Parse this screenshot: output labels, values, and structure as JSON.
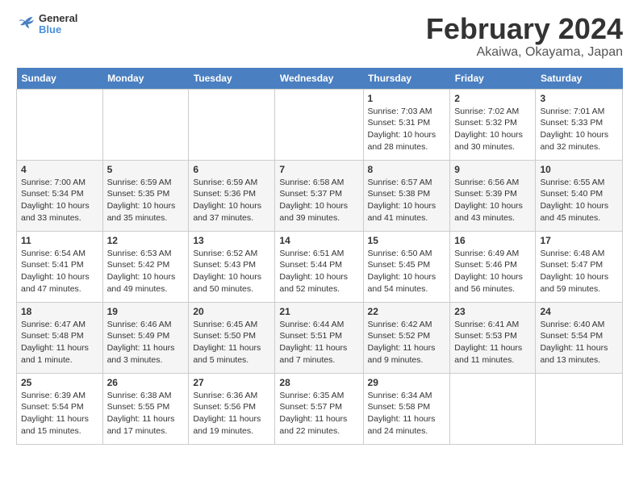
{
  "header": {
    "logo_general": "General",
    "logo_blue": "Blue",
    "month_title": "February 2024",
    "location": "Akaiwa, Okayama, Japan"
  },
  "weekdays": [
    "Sunday",
    "Monday",
    "Tuesday",
    "Wednesday",
    "Thursday",
    "Friday",
    "Saturday"
  ],
  "weeks": [
    [
      {
        "day": "",
        "detail": ""
      },
      {
        "day": "",
        "detail": ""
      },
      {
        "day": "",
        "detail": ""
      },
      {
        "day": "",
        "detail": ""
      },
      {
        "day": "1",
        "detail": "Sunrise: 7:03 AM\nSunset: 5:31 PM\nDaylight: 10 hours\nand 28 minutes."
      },
      {
        "day": "2",
        "detail": "Sunrise: 7:02 AM\nSunset: 5:32 PM\nDaylight: 10 hours\nand 30 minutes."
      },
      {
        "day": "3",
        "detail": "Sunrise: 7:01 AM\nSunset: 5:33 PM\nDaylight: 10 hours\nand 32 minutes."
      }
    ],
    [
      {
        "day": "4",
        "detail": "Sunrise: 7:00 AM\nSunset: 5:34 PM\nDaylight: 10 hours\nand 33 minutes."
      },
      {
        "day": "5",
        "detail": "Sunrise: 6:59 AM\nSunset: 5:35 PM\nDaylight: 10 hours\nand 35 minutes."
      },
      {
        "day": "6",
        "detail": "Sunrise: 6:59 AM\nSunset: 5:36 PM\nDaylight: 10 hours\nand 37 minutes."
      },
      {
        "day": "7",
        "detail": "Sunrise: 6:58 AM\nSunset: 5:37 PM\nDaylight: 10 hours\nand 39 minutes."
      },
      {
        "day": "8",
        "detail": "Sunrise: 6:57 AM\nSunset: 5:38 PM\nDaylight: 10 hours\nand 41 minutes."
      },
      {
        "day": "9",
        "detail": "Sunrise: 6:56 AM\nSunset: 5:39 PM\nDaylight: 10 hours\nand 43 minutes."
      },
      {
        "day": "10",
        "detail": "Sunrise: 6:55 AM\nSunset: 5:40 PM\nDaylight: 10 hours\nand 45 minutes."
      }
    ],
    [
      {
        "day": "11",
        "detail": "Sunrise: 6:54 AM\nSunset: 5:41 PM\nDaylight: 10 hours\nand 47 minutes."
      },
      {
        "day": "12",
        "detail": "Sunrise: 6:53 AM\nSunset: 5:42 PM\nDaylight: 10 hours\nand 49 minutes."
      },
      {
        "day": "13",
        "detail": "Sunrise: 6:52 AM\nSunset: 5:43 PM\nDaylight: 10 hours\nand 50 minutes."
      },
      {
        "day": "14",
        "detail": "Sunrise: 6:51 AM\nSunset: 5:44 PM\nDaylight: 10 hours\nand 52 minutes."
      },
      {
        "day": "15",
        "detail": "Sunrise: 6:50 AM\nSunset: 5:45 PM\nDaylight: 10 hours\nand 54 minutes."
      },
      {
        "day": "16",
        "detail": "Sunrise: 6:49 AM\nSunset: 5:46 PM\nDaylight: 10 hours\nand 56 minutes."
      },
      {
        "day": "17",
        "detail": "Sunrise: 6:48 AM\nSunset: 5:47 PM\nDaylight: 10 hours\nand 59 minutes."
      }
    ],
    [
      {
        "day": "18",
        "detail": "Sunrise: 6:47 AM\nSunset: 5:48 PM\nDaylight: 11 hours\nand 1 minute."
      },
      {
        "day": "19",
        "detail": "Sunrise: 6:46 AM\nSunset: 5:49 PM\nDaylight: 11 hours\nand 3 minutes."
      },
      {
        "day": "20",
        "detail": "Sunrise: 6:45 AM\nSunset: 5:50 PM\nDaylight: 11 hours\nand 5 minutes."
      },
      {
        "day": "21",
        "detail": "Sunrise: 6:44 AM\nSunset: 5:51 PM\nDaylight: 11 hours\nand 7 minutes."
      },
      {
        "day": "22",
        "detail": "Sunrise: 6:42 AM\nSunset: 5:52 PM\nDaylight: 11 hours\nand 9 minutes."
      },
      {
        "day": "23",
        "detail": "Sunrise: 6:41 AM\nSunset: 5:53 PM\nDaylight: 11 hours\nand 11 minutes."
      },
      {
        "day": "24",
        "detail": "Sunrise: 6:40 AM\nSunset: 5:54 PM\nDaylight: 11 hours\nand 13 minutes."
      }
    ],
    [
      {
        "day": "25",
        "detail": "Sunrise: 6:39 AM\nSunset: 5:54 PM\nDaylight: 11 hours\nand 15 minutes."
      },
      {
        "day": "26",
        "detail": "Sunrise: 6:38 AM\nSunset: 5:55 PM\nDaylight: 11 hours\nand 17 minutes."
      },
      {
        "day": "27",
        "detail": "Sunrise: 6:36 AM\nSunset: 5:56 PM\nDaylight: 11 hours\nand 19 minutes."
      },
      {
        "day": "28",
        "detail": "Sunrise: 6:35 AM\nSunset: 5:57 PM\nDaylight: 11 hours\nand 22 minutes."
      },
      {
        "day": "29",
        "detail": "Sunrise: 6:34 AM\nSunset: 5:58 PM\nDaylight: 11 hours\nand 24 minutes."
      },
      {
        "day": "",
        "detail": ""
      },
      {
        "day": "",
        "detail": ""
      }
    ]
  ]
}
